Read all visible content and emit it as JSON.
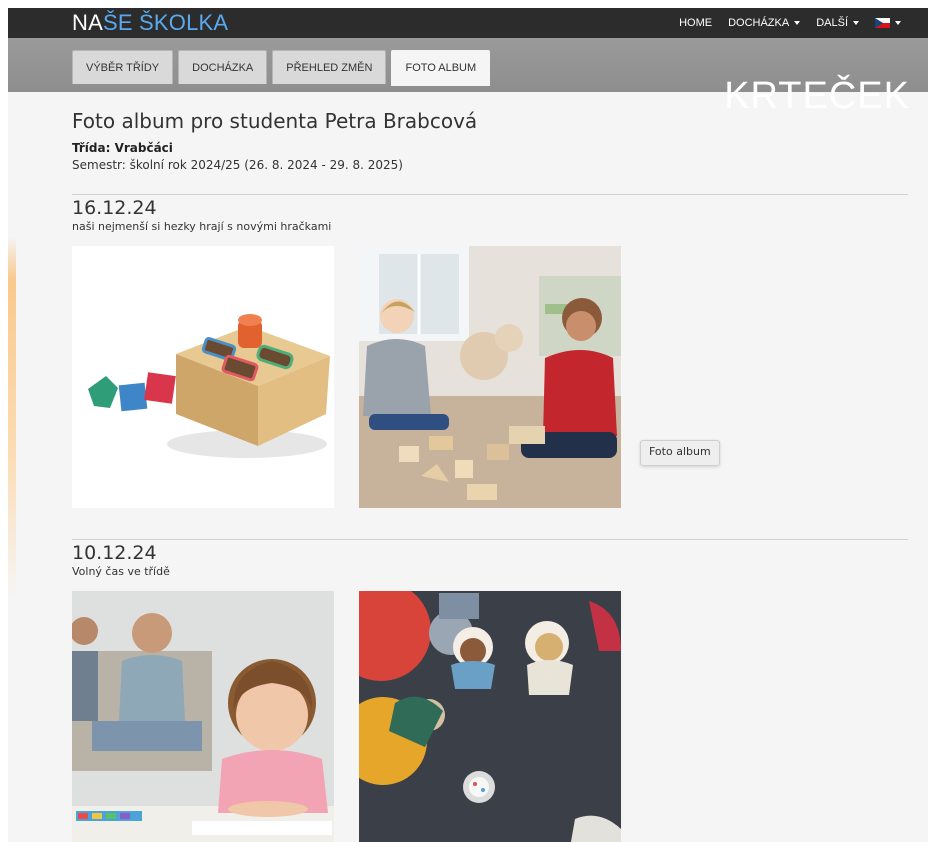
{
  "brand": {
    "part1": "NA",
    "part2": "ŠE Š",
    "part3": "KOLKA"
  },
  "topnav": {
    "home": "HOME",
    "attendance": "DOCHÁZKA",
    "more": "DALŠÍ",
    "language_icon": "czech-flag-icon"
  },
  "tabs": [
    {
      "label": "VÝBĚR TŘÍDY"
    },
    {
      "label": "DOCHÁZKA"
    },
    {
      "label": "PŘEHLED ZMĚN"
    },
    {
      "label": "FOTO ALBUM",
      "active": true
    }
  ],
  "class_logo": "KRTEČEK",
  "page": {
    "title": "Foto album pro studenta Petra Brabcová",
    "class_line": "Třída: Vrabčáci",
    "semester_line": "Semestr: školní rok 2024/25 (26. 8. 2024 - 29. 8. 2025)"
  },
  "albums": [
    {
      "date": "16.12.24",
      "caption": "naši nejmenší si hezky hrají s novými hračkami"
    },
    {
      "date": "10.12.24",
      "caption": "Volný čas ve třídě"
    }
  ],
  "tooltip": "Foto album",
  "colors": {
    "topbar": "#2c2c2c",
    "brand_accent": "#5aa9ee",
    "tab_band": "#8e8e8e",
    "content_bg": "#f5f5f5"
  }
}
